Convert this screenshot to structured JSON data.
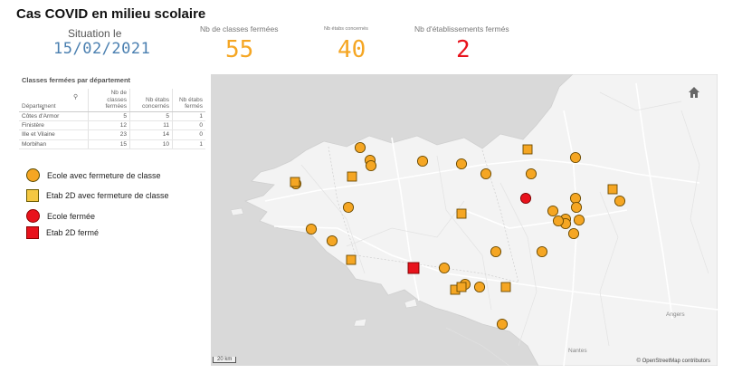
{
  "header": {
    "title": "Cas COVID en milieu scolaire",
    "situation_label": "Situation le",
    "situation_date": "15/02/2021"
  },
  "kpis": [
    {
      "label": "Nb de classes fermées",
      "value": "55",
      "color": "#f5a623"
    },
    {
      "label": "Nb étabs concernés",
      "value": "40",
      "color": "#f5a623"
    },
    {
      "label": "Nb d'établissements fermés",
      "value": "2",
      "color": "#e8121c"
    }
  ],
  "table": {
    "title": "Classes fermées par département",
    "headers": [
      "Département",
      "Nb de classes fermées",
      "Nb étabs concernés",
      "Nb étabs fermés"
    ],
    "rows": [
      [
        "Côtes d'Armor",
        "5",
        "5",
        "1"
      ],
      [
        "Finistère",
        "12",
        "11",
        "0"
      ],
      [
        "Ille et Vilaine",
        "23",
        "14",
        "0"
      ],
      [
        "Morbihan",
        "15",
        "10",
        "1"
      ]
    ]
  },
  "legend": [
    {
      "label": "Ecole avec fermeture de classe",
      "symbol": "circle-orange"
    },
    {
      "label": "Etab 2D avec fermeture de classe",
      "symbol": "square-orange"
    },
    {
      "label": "Ecole fermée",
      "symbol": "circle-red"
    },
    {
      "label": "Etab 2D fermé",
      "symbol": "square-red"
    }
  ],
  "map": {
    "cities": {
      "angers": "Angers",
      "nantes": "Nantes"
    },
    "scale": "20 km",
    "attribution": "© OpenStreetMap contributors",
    "colors": {
      "school": "#f5a623",
      "school_outline": "#6b4a00",
      "etab2d": "#f5a623",
      "closed": "#e8121c",
      "sea": "#d6d6d6",
      "land": "#f4f4f4",
      "road": "#ffffff"
    }
  }
}
